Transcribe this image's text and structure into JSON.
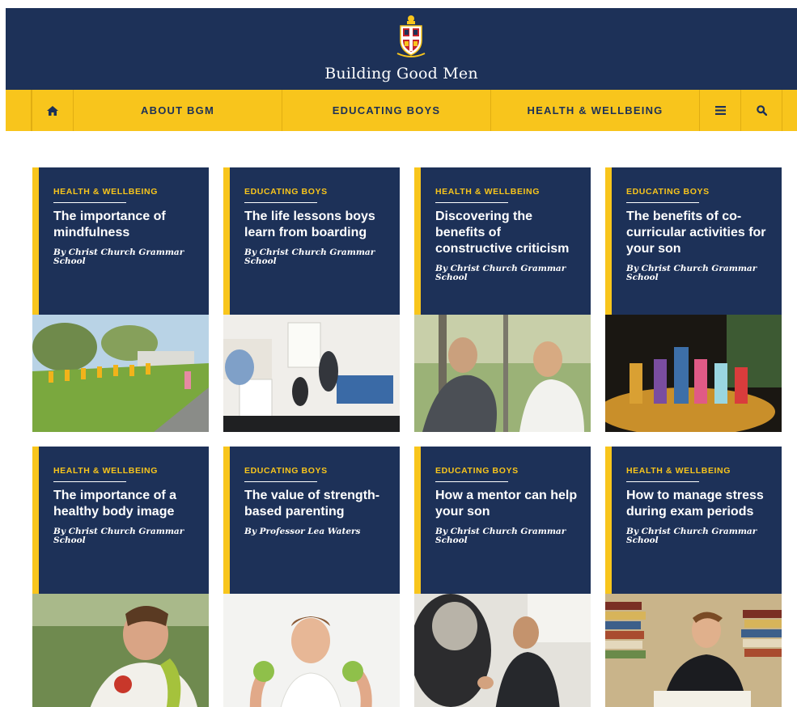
{
  "site": {
    "title": "Building Good Men"
  },
  "nav": {
    "home_icon": "home-icon",
    "items": [
      "ABOUT BGM",
      "EDUCATING BOYS",
      "HEALTH & WELLBEING"
    ],
    "menu_icon": "menu-icon",
    "search_icon": "search-icon"
  },
  "colors": {
    "navy": "#1d3158",
    "gold": "#f8c51c"
  },
  "cards": [
    {
      "category": "HEALTH & WELLBEING",
      "title": "The importance of mindfulness",
      "author": "By Christ Church Grammar School",
      "photo": "yoga-class-photo"
    },
    {
      "category": "EDUCATING BOYS",
      "title": "The life lessons boys learn from boarding",
      "author": "By Christ Church Grammar School",
      "photo": "boarding-room-photo"
    },
    {
      "category": "HEALTH & WELLBEING",
      "title": "Discovering the benefits of constructive criticism",
      "author": "By Christ Church Grammar School",
      "photo": "two-boys-talking-photo"
    },
    {
      "category": "EDUCATING BOYS",
      "title": "The benefits of co-curricular activities for your son",
      "author": "By Christ Church Grammar School",
      "photo": "stage-performance-photo"
    },
    {
      "category": "HEALTH & WELLBEING",
      "title": "The importance of a healthy body image",
      "author": "By Christ Church Grammar School",
      "photo": "boy-with-apple-photo"
    },
    {
      "category": "EDUCATING BOYS",
      "title": "The value of strength-based parenting",
      "author": "By Professor Lea Waters",
      "photo": "child-flexing-photo"
    },
    {
      "category": "EDUCATING BOYS",
      "title": "How a mentor can help your son",
      "author": "By Christ Church Grammar School",
      "photo": "mentor-conversation-photo"
    },
    {
      "category": "HEALTH & WELLBEING",
      "title": "How to manage stress during exam periods",
      "author": "By Christ Church Grammar School",
      "photo": "student-studying-photo"
    }
  ]
}
